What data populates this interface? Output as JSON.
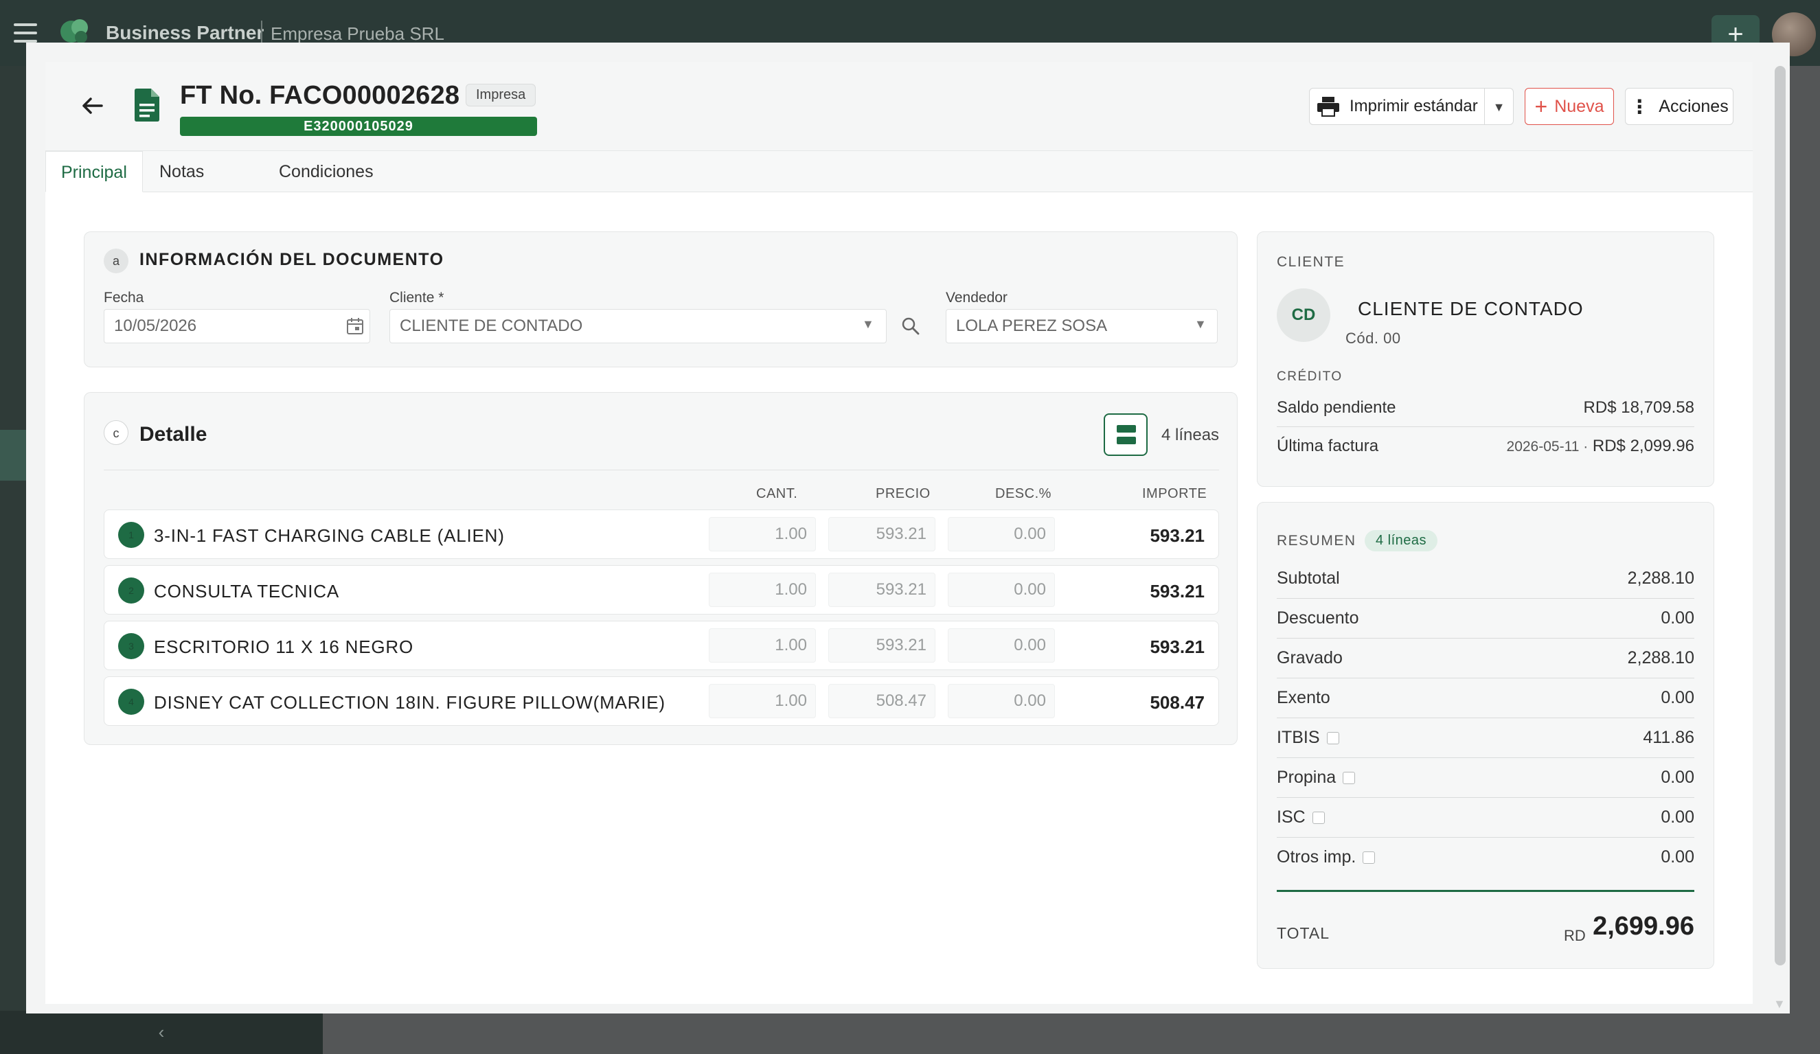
{
  "app": {
    "name": "Business Partner",
    "company": "Empresa Prueba SRL"
  },
  "document": {
    "title": "FT No. FACO00002628",
    "status": "Impresa",
    "ecf": "E320000105029"
  },
  "toolbar": {
    "print_label": "Imprimir estándar",
    "new_label": "Nueva",
    "actions_label": "Acciones"
  },
  "tabs": [
    {
      "label": "Principal"
    },
    {
      "label": "Notas"
    },
    {
      "label": "Condiciones"
    }
  ],
  "info": {
    "badge": "a",
    "title": "INFORMACIÓN DEL DOCUMENTO",
    "fecha_label": "Fecha",
    "fecha_value": "10/05/2026",
    "cliente_label": "Cliente *",
    "cliente_value": "CLIENTE DE CONTADO",
    "vendedor_label": "Vendedor",
    "vendedor_value": "LOLA PEREZ SOSA"
  },
  "detalle": {
    "badge": "c",
    "title": "Detalle",
    "count": "4 líneas",
    "columns": {
      "cant": "CANT.",
      "precio": "PRECIO",
      "desc": "DESC.%",
      "importe": "IMPORTE"
    },
    "rows": [
      {
        "num": "1",
        "desc": "3-IN-1 FAST CHARGING CABLE (ALIEN)",
        "cant": "1.00",
        "precio": "593.21",
        "descp": "0.00",
        "importe": "593.21"
      },
      {
        "num": "2",
        "desc": "CONSULTA TECNICA",
        "cant": "1.00",
        "precio": "593.21",
        "descp": "0.00",
        "importe": "593.21"
      },
      {
        "num": "3",
        "desc": "ESCRITORIO 11 X 16 NEGRO",
        "cant": "1.00",
        "precio": "593.21",
        "descp": "0.00",
        "importe": "593.21"
      },
      {
        "num": "4",
        "desc": "DISNEY CAT COLLECTION 18IN. FIGURE PILLOW(MARIE)",
        "cant": "1.00",
        "precio": "508.47",
        "descp": "0.00",
        "importe": "508.47"
      }
    ]
  },
  "cliente": {
    "heading": "CLIENTE",
    "initials": "CD",
    "name": "CLIENTE DE CONTADO",
    "code": "Cód. 00",
    "credito_heading": "CRÉDITO",
    "saldo_label": "Saldo pendiente",
    "saldo_value": "RD$ 18,709.58",
    "ultima_label": "Última factura",
    "ultima_date": "2026-05-11 ·",
    "ultima_value": "RD$ 2,099.96"
  },
  "resumen": {
    "heading": "RESUMEN",
    "pill": "4 líneas",
    "rows": [
      {
        "label": "Subtotal",
        "value": "2,288.10"
      },
      {
        "label": "Descuento",
        "value": "0.00"
      },
      {
        "label": "Gravado",
        "value": "2,288.10"
      },
      {
        "label": "Exento",
        "value": "0.00"
      },
      {
        "label": "ITBIS",
        "value": "411.86"
      },
      {
        "label": "Propina",
        "value": "0.00"
      },
      {
        "label": "ISC",
        "value": "0.00"
      },
      {
        "label": "Otros imp.",
        "value": "0.00"
      }
    ],
    "total_label": "TOTAL",
    "total_currency": "RD",
    "total_value": "2,699.96"
  },
  "colors": {
    "accent": "#1e6b44",
    "badge_green": "#1f7a3a",
    "danger": "#e0524a"
  }
}
